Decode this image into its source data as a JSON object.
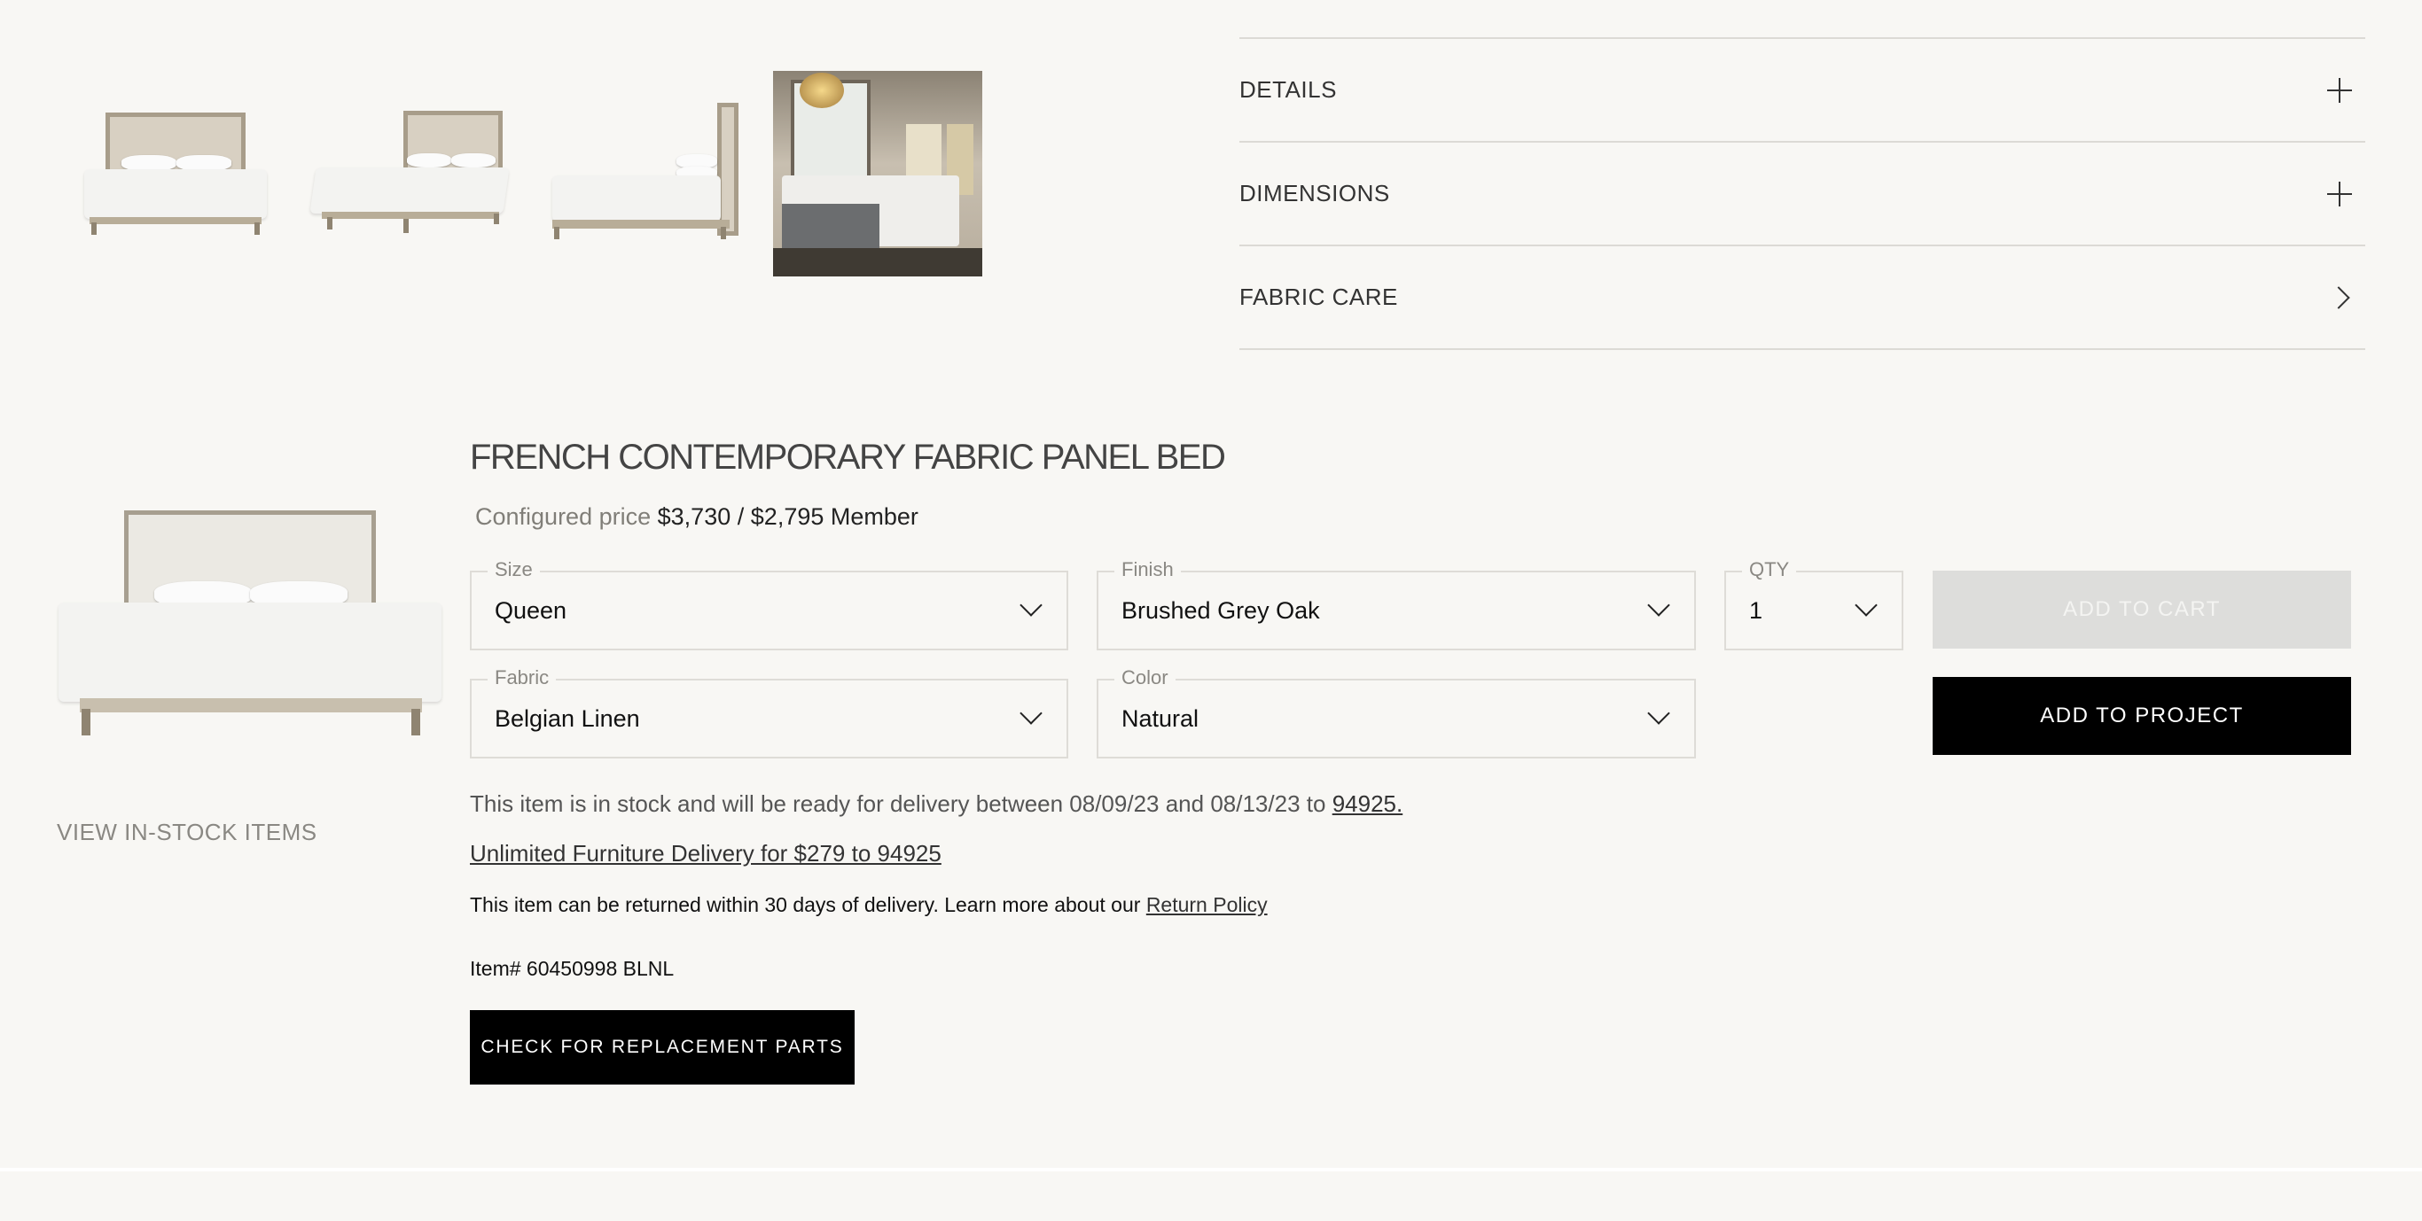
{
  "accordion": {
    "items": [
      {
        "label": "DETAILS",
        "icon": "plus-icon"
      },
      {
        "label": "DIMENSIONS",
        "icon": "plus-icon"
      },
      {
        "label": "FABRIC CARE",
        "icon": "chevron-right-icon"
      }
    ]
  },
  "product": {
    "title": "FRENCH CONTEMPORARY FABRIC PANEL BED",
    "price_label": "Configured price",
    "price_regular": "$3,730",
    "price_separator": "/",
    "price_member": "$2,795 Member",
    "view_instock": "VIEW IN-STOCK ITEMS"
  },
  "options": {
    "size": {
      "label": "Size",
      "value": "Queen"
    },
    "finish": {
      "label": "Finish",
      "value": "Brushed Grey Oak"
    },
    "qty": {
      "label": "QTY",
      "value": "1"
    },
    "fabric": {
      "label": "Fabric",
      "value": "Belgian Linen"
    },
    "color": {
      "label": "Color",
      "value": "Natural"
    }
  },
  "actions": {
    "add_to_cart": "ADD TO CART",
    "add_to_project": "ADD TO PROJECT",
    "replacement_parts": "CHECK FOR REPLACEMENT PARTS"
  },
  "info": {
    "stock_text": "This item is in stock and will be ready for delivery between 08/09/23 and 08/13/23 to",
    "stock_zip": "94925.",
    "delivery_link": "Unlimited Furniture Delivery for $279 to 94925",
    "return_text": "This item can be returned within 30 days of delivery. Learn more about our",
    "return_link": "Return Policy",
    "item_number": "Item# 60450998 BLNL"
  },
  "colors": {
    "background": "#f8f7f4",
    "button_primary": "#000000",
    "button_disabled": "#dddddb"
  }
}
